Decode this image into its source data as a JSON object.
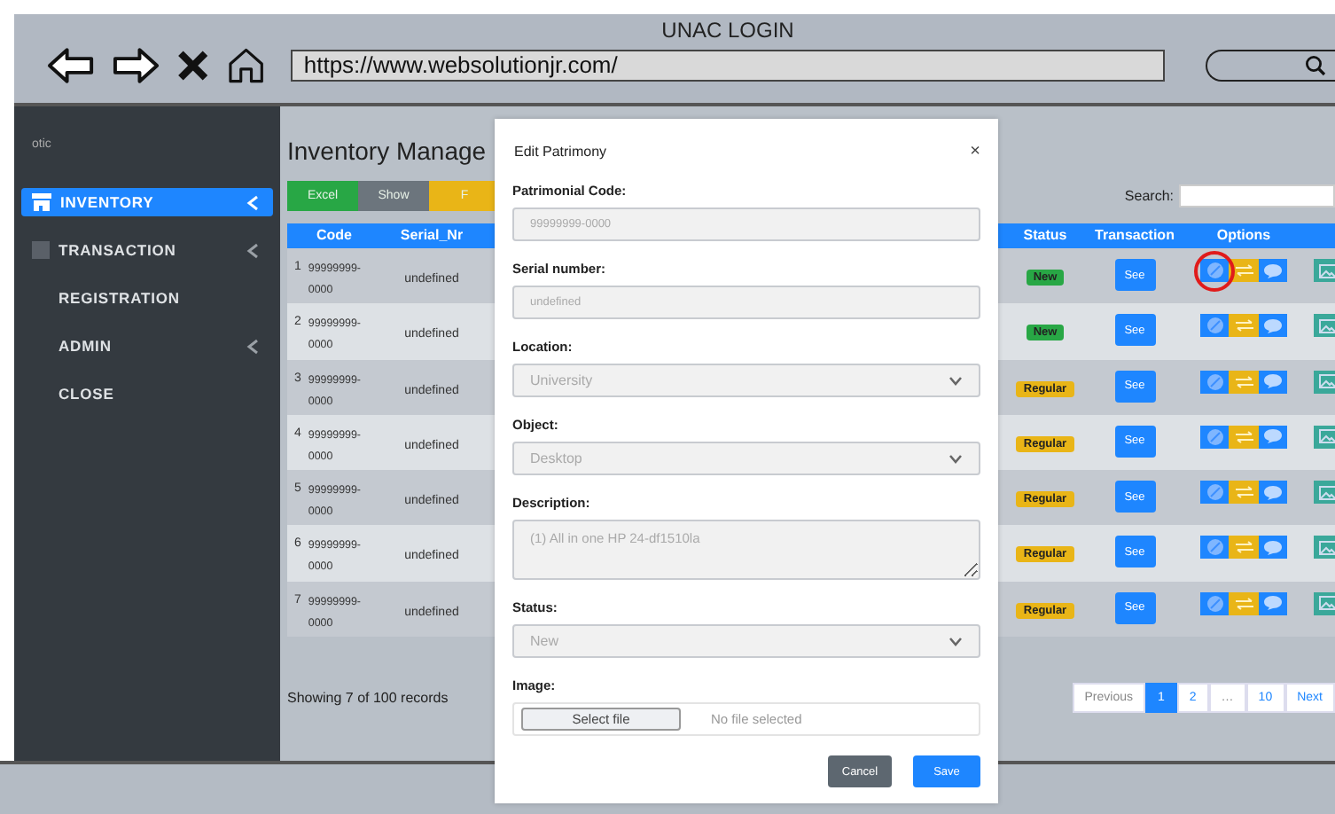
{
  "browser": {
    "title": "UNAC LOGIN",
    "url": "https://www.websolutionjr.com/"
  },
  "sidebar": {
    "brand": "otic",
    "items": [
      {
        "label": "INVENTORY",
        "selected": true,
        "kind": "store",
        "chevron": true
      },
      {
        "label": "TRANSACTION",
        "selected": false,
        "kind": "square",
        "chevron": true
      },
      {
        "label": "REGISTRATION",
        "selected": false,
        "kind": "plain",
        "chevron": false
      },
      {
        "label": "ADMIN",
        "selected": false,
        "kind": "plain",
        "chevron": true
      },
      {
        "label": "CLOSE",
        "selected": false,
        "kind": "plain",
        "chevron": false
      }
    ]
  },
  "page_title": "Inventory Manage",
  "toolbar": [
    {
      "label": "Excel",
      "color": "#28a745"
    },
    {
      "label": "Show",
      "color": "#6c757d"
    },
    {
      "label": "F",
      "color": "#e9b517"
    }
  ],
  "search": {
    "label": "Search:"
  },
  "table": {
    "columns": [
      "Code",
      "Serial_Nr",
      "Status",
      "Transaction",
      "Options"
    ],
    "rows": [
      {
        "index": "1",
        "code": "99999999-0000",
        "serial": "undefined",
        "status": "New",
        "color": "#28a745",
        "transaction": "See",
        "highlight": true
      },
      {
        "index": "2",
        "code": "99999999-0000",
        "serial": "undefined",
        "status": "New",
        "color": "#28a745",
        "transaction": "See",
        "highlight": false
      },
      {
        "index": "3",
        "code": "99999999-0000",
        "serial": "undefined",
        "status": "Regular",
        "color": "#e9b517",
        "transaction": "See",
        "highlight": false
      },
      {
        "index": "4",
        "code": "99999999-0000",
        "serial": "undefined",
        "status": "Regular",
        "color": "#e9b517",
        "transaction": "See",
        "highlight": false
      },
      {
        "index": "5",
        "code": "99999999-0000",
        "serial": "undefined",
        "status": "Regular",
        "color": "#e9b517",
        "transaction": "See",
        "highlight": false
      },
      {
        "index": "6",
        "code": "99999999-0000",
        "serial": "undefined",
        "status": "Regular",
        "color": "#e9b517",
        "transaction": "See",
        "highlight": false
      },
      {
        "index": "7",
        "code": "99999999-0000",
        "serial": "undefined",
        "status": "Regular",
        "color": "#e9b517",
        "transaction": "See",
        "highlight": false
      }
    ]
  },
  "records_info": "Showing 7 of 100 records",
  "pagination": [
    {
      "label": "Previous",
      "selected": false,
      "disabled": true
    },
    {
      "label": "1",
      "selected": true,
      "disabled": false
    },
    {
      "label": "2",
      "selected": false,
      "disabled": false
    },
    {
      "label": "…",
      "selected": false,
      "disabled": true
    },
    {
      "label": "10",
      "selected": false,
      "disabled": false
    },
    {
      "label": "Next",
      "selected": false,
      "disabled": false
    }
  ],
  "modal": {
    "title": "Edit Patrimony",
    "close": "×",
    "fields": [
      {
        "kind": "text",
        "label": "Patrimonial Code:",
        "value": "99999999-0000"
      },
      {
        "kind": "text",
        "label": "Serial number:",
        "value": "undefined"
      },
      {
        "kind": "select",
        "label": "Location:",
        "value": "University"
      },
      {
        "kind": "select",
        "label": "Object:",
        "value": "Desktop"
      },
      {
        "kind": "textarea",
        "label": "Description:",
        "value": "(1) All in one HP 24-df1510la"
      },
      {
        "kind": "select",
        "label": "Status:",
        "value": "New"
      },
      {
        "kind": "file",
        "label": "Image:",
        "button": "Select file",
        "value": "No file selected"
      }
    ],
    "buttons": [
      {
        "label": "Cancel",
        "kind": "secondary"
      },
      {
        "label": "Save",
        "kind": "primary"
      }
    ]
  }
}
